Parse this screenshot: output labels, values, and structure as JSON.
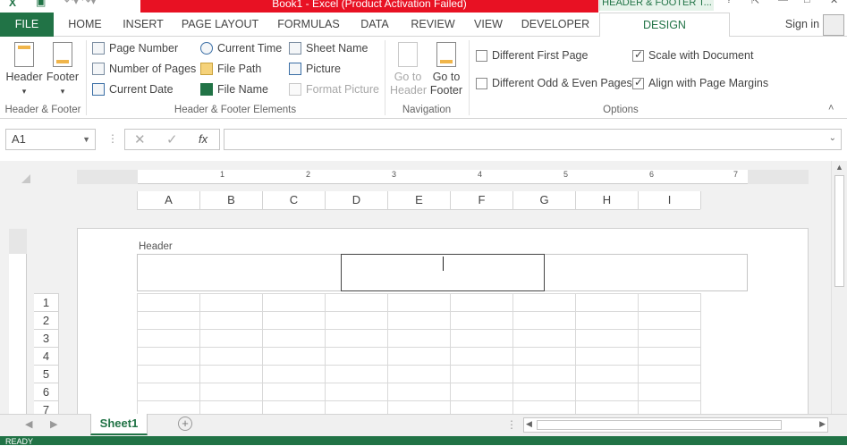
{
  "window": {
    "title": "Book1 - Excel (Product Activation Failed)",
    "context_tab": "HEADER & FOOTER T...",
    "sign_in": "Sign in"
  },
  "tabs": [
    "FILE",
    "HOME",
    "INSERT",
    "PAGE LAYOUT",
    "FORMULAS",
    "DATA",
    "REVIEW",
    "VIEW",
    "DEVELOPER",
    "DESIGN"
  ],
  "ribbon": {
    "header_footer_group": {
      "label": "Header & Footer",
      "header_btn": "Header",
      "footer_btn": "Footer"
    },
    "elements_group": {
      "label": "Header & Footer Elements",
      "page_number": "Page Number",
      "number_of_pages": "Number of Pages",
      "current_date": "Current Date",
      "current_time": "Current Time",
      "file_path": "File Path",
      "file_name": "File Name",
      "sheet_name": "Sheet Name",
      "picture": "Picture",
      "format_picture": "Format Picture"
    },
    "navigation_group": {
      "label": "Navigation",
      "goto_header": "Go to Header",
      "goto_header_l1": "Go to",
      "goto_header_l2": "Header",
      "goto_footer_l1": "Go to",
      "goto_footer_l2": "Footer"
    },
    "options_group": {
      "label": "Options",
      "diff_first": "Different First Page",
      "diff_odd_even": "Different Odd & Even Pages",
      "scale_doc": "Scale with Document",
      "align_margins": "Align with Page Margins",
      "diff_first_checked": false,
      "diff_odd_even_checked": false,
      "scale_doc_checked": true,
      "align_margins_checked": true
    }
  },
  "formula_bar": {
    "name_box": "A1",
    "fx": "fx",
    "formula": ""
  },
  "ruler": [
    "1",
    "2",
    "3",
    "4",
    "5",
    "6",
    "7"
  ],
  "columns": [
    "A",
    "B",
    "C",
    "D",
    "E",
    "F",
    "G",
    "H",
    "I"
  ],
  "rows": [
    "1",
    "2",
    "3",
    "4",
    "5",
    "6",
    "7"
  ],
  "page": {
    "header_label": "Header"
  },
  "sheets": {
    "active": "Sheet1"
  },
  "status": {
    "ready": "READY"
  },
  "colors": {
    "accent": "#217346",
    "title_red": "#e81123"
  }
}
